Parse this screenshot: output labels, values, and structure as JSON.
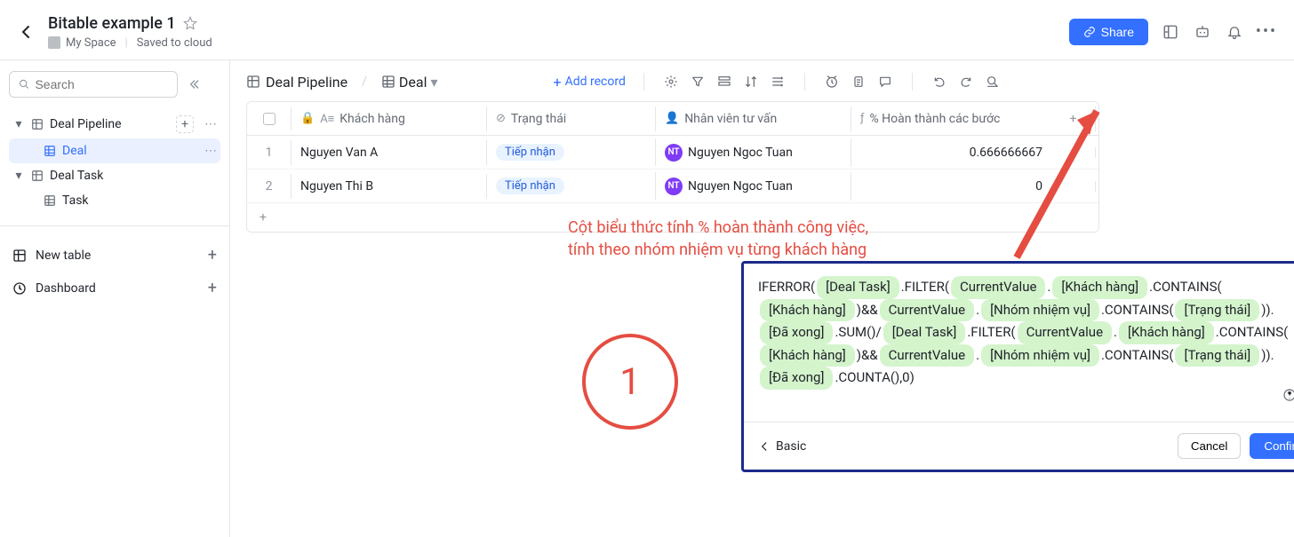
{
  "header": {
    "title": "Bitable example 1",
    "folder": "My Space",
    "saved": "Saved to cloud",
    "share": "Share"
  },
  "sidebar": {
    "search_placeholder": "Search",
    "items": [
      {
        "label": "Deal Pipeline"
      },
      {
        "label": "Deal"
      },
      {
        "label": "Deal Task"
      },
      {
        "label": "Task"
      }
    ],
    "new_table": "New table",
    "dashboard": "Dashboard"
  },
  "toolbar": {
    "breadcrumb": "Deal Pipeline",
    "tab": "Deal",
    "add_record": "Add record"
  },
  "table": {
    "columns": [
      "Khách hàng",
      "Trạng thái",
      "Nhân viên tư vấn",
      "% Hoàn thành các bước"
    ],
    "rows": [
      {
        "n": "1",
        "kh": "Nguyen Van A",
        "tt": "Tiếp nhận",
        "nv": "Nguyen Ngoc Tuan",
        "avatar": "NT",
        "pct": "0.666666667"
      },
      {
        "n": "2",
        "kh": "Nguyen Thi B",
        "tt": "Tiếp nhận",
        "nv": "Nguyen Ngoc Tuan",
        "avatar": "NT",
        "pct": "0"
      }
    ]
  },
  "annotation": {
    "line1": "Cột biểu thức tính % hoàn thành công việc,",
    "line2": "tính theo nhóm nhiệm vụ từng khách hàng",
    "circle": "1"
  },
  "formula": {
    "parts": [
      "IFERROR(",
      {
        "t": "[Deal Task]"
      },
      ".FILTER(",
      {
        "t": "CurrentValue"
      },
      ".",
      {
        "t": "[Khách hàng]"
      },
      ".CONTAINS(",
      {
        "t": "[Khách hàng]"
      },
      ")&&",
      {
        "t": "CurrentValue"
      },
      ".",
      {
        "t": "[Nhóm nhiệm vụ]"
      },
      ".CONTAINS(",
      {
        "t": "[Trạng thái]"
      },
      ")).",
      {
        "t": "[Đã xong]"
      },
      ".SUM()/",
      {
        "t": "[Deal Task]"
      },
      ".FILTER(",
      {
        "t": "CurrentValue"
      },
      ".",
      {
        "t": "[Khách hàng]"
      },
      ".CONTAINS(",
      {
        "t": "[Khách hàng]"
      },
      ")&&",
      {
        "t": "CurrentValue"
      },
      ".",
      {
        "t": "[Nhóm nhiệm vụ]"
      },
      ".CONTAINS(",
      {
        "t": "[Trạng thái]"
      },
      ")).",
      {
        "t": "[Đã xong]"
      },
      ".COUNTA(),0)"
    ],
    "basic": "Basic",
    "cancel": "Cancel",
    "confirm": "Confirm"
  }
}
